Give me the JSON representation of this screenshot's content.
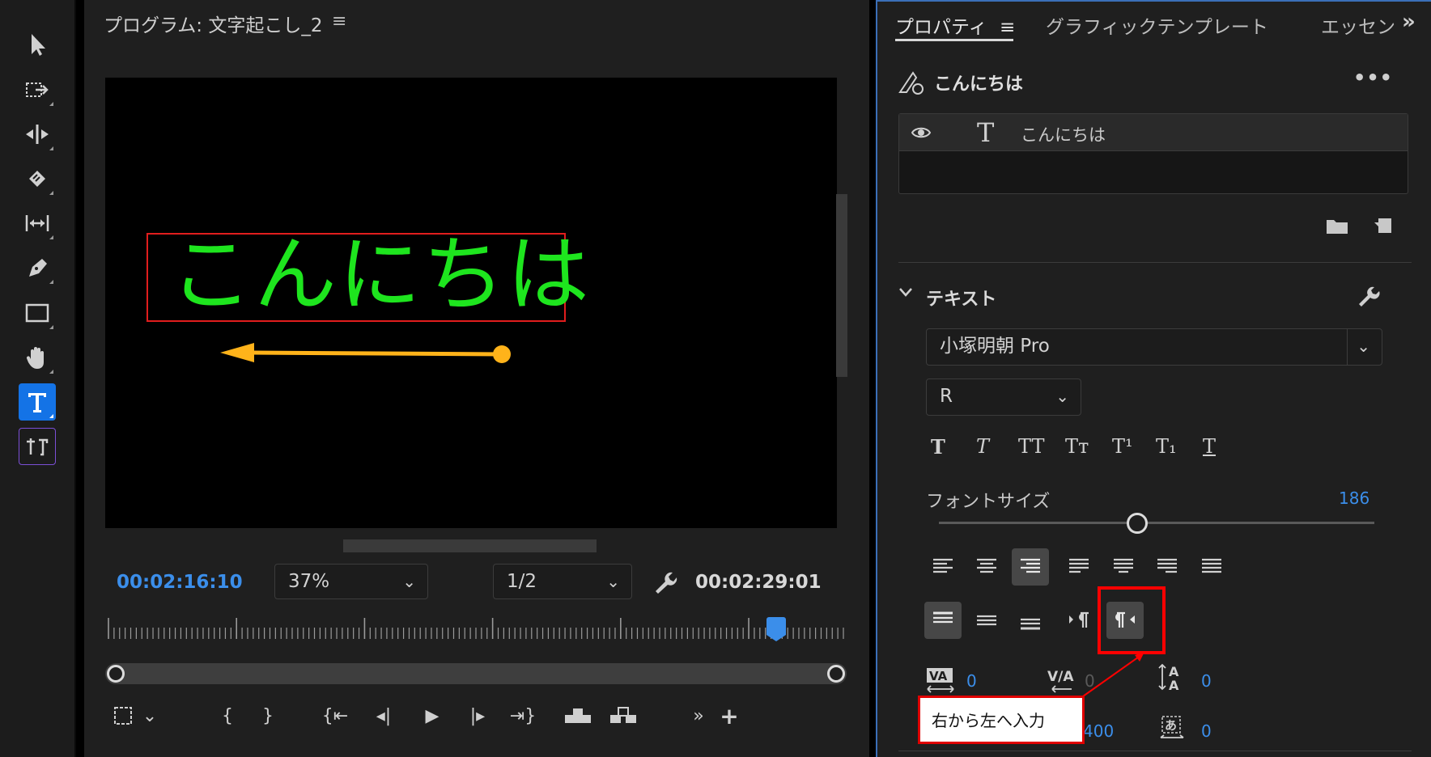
{
  "tools": {
    "items": [
      "selection",
      "track-select-forward",
      "ripple-edit",
      "razor",
      "slip",
      "pen",
      "rectangle",
      "hand",
      "type",
      "vertical-type"
    ],
    "active": "type"
  },
  "monitor": {
    "title": "プログラム: 文字起こし_2",
    "canvas_text": "こんにちは",
    "timecode_current": "00:02:16:10",
    "zoom": "37%",
    "resolution": "1/2",
    "timecode_duration": "00:02:29:01"
  },
  "properties": {
    "tabs": [
      {
        "label": "プロパティ"
      },
      {
        "label": "グラフィックテンプレート"
      },
      {
        "label": "エッセン"
      }
    ],
    "clip_name": "こんにちは",
    "layer_name": "こんにちは",
    "section_title": "テキスト",
    "font_family": "小塚明朝 Pro",
    "font_style": "R",
    "type_style_glyphs": [
      "T",
      "T",
      "TT",
      "Tт",
      "T¹",
      "T₁",
      "T"
    ],
    "font_size_label": "フォントサイズ",
    "font_size_value": "186",
    "kerning_value": "0",
    "tracking_value": "0",
    "leading_value": "0",
    "extra_value": "400",
    "tsume_value": "0"
  },
  "annotation": {
    "callout_text": "右から左へ入力"
  },
  "colors": {
    "accent_blue": "#3b8eea",
    "canvas_text": "#1ee51e",
    "arrow": "#ffb31a",
    "highlight_red": "#ff0000"
  }
}
